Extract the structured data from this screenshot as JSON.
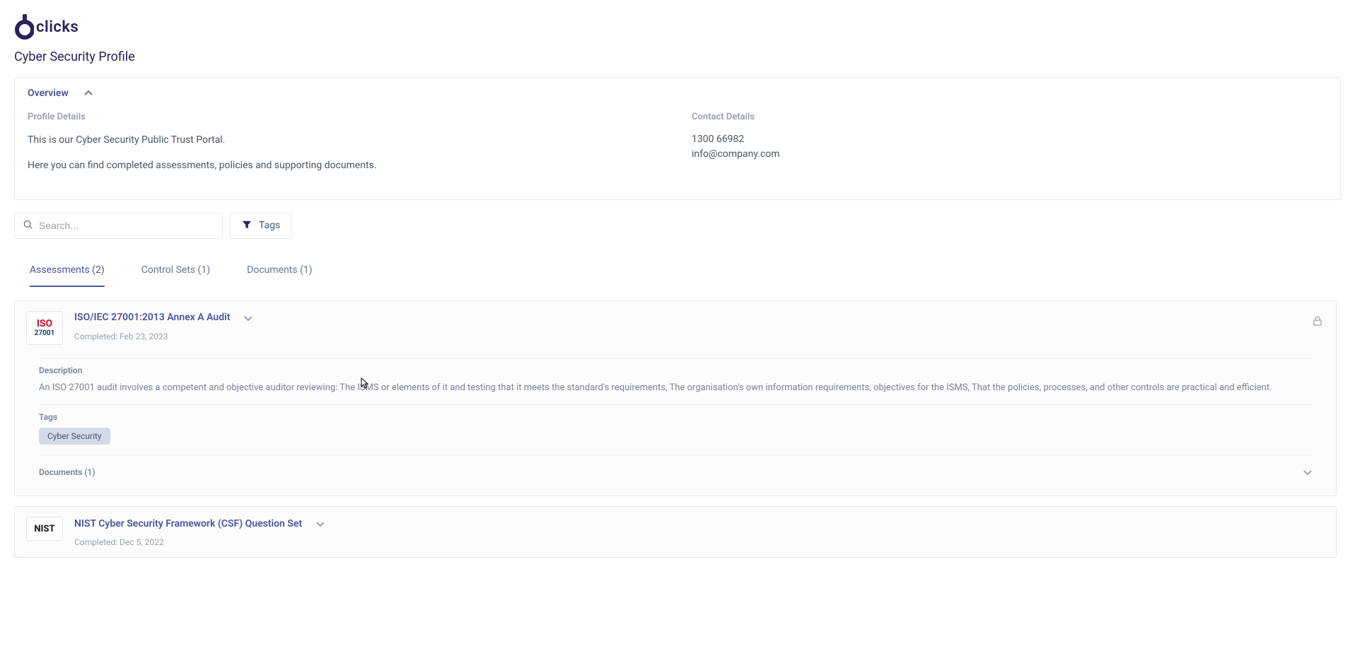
{
  "brand": {
    "name": "clicks"
  },
  "page_title": "Cyber Security Profile",
  "overview": {
    "label": "Overview",
    "profile": {
      "label": "Profile Details",
      "line1": "This is our Cyber Security Public Trust Portal.",
      "line2": "Here you can find completed assessments, policies and supporting documents."
    },
    "contact": {
      "label": "Contact Details",
      "phone": "1300 66982",
      "email": "info@company.com"
    }
  },
  "search": {
    "placeholder": "Search..."
  },
  "tags_filter": {
    "label": "Tags"
  },
  "tabs": {
    "assessments": "Assessments (2)",
    "control_sets": "Control Sets (1)",
    "documents": "Documents (1)"
  },
  "assessments": [
    {
      "title": "ISO/IEC 27001:2013 Annex A Audit",
      "completed": "Completed: Feb 23, 2023",
      "description_label": "Description",
      "description": "An ISO 27001 audit involves a competent and objective auditor reviewing: The ISMS or elements of it and testing that it meets the standard's requirements, The organisation's own information requirements, objectives for the ISMS, That the policies, processes, and other controls are practical and efficient.",
      "tags_label": "Tags",
      "tags": [
        "Cyber Security"
      ],
      "documents_label": "Documents (1)"
    },
    {
      "title": "NIST Cyber Security Framework (CSF) Question Set",
      "completed": "Completed: Dec 5, 2022"
    }
  ]
}
